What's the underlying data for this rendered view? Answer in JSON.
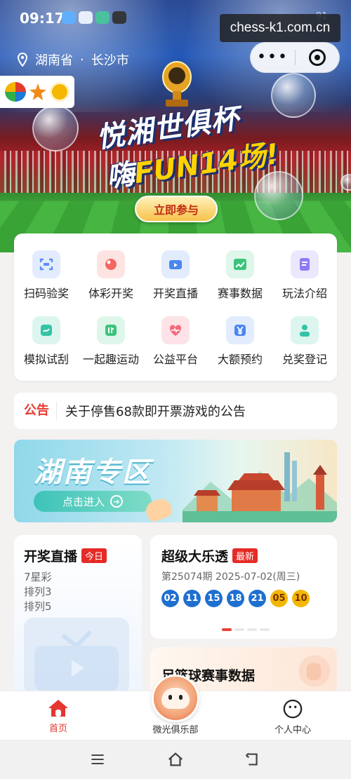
{
  "status_bar": {
    "time": "09:17",
    "battery": "91"
  },
  "watermark": "chess-k1.com.cn",
  "location": {
    "province": "湖南省",
    "separator": "·",
    "city": "长沙市"
  },
  "capsule": {
    "more_glyph": "•••"
  },
  "hero": {
    "headline_line1": "悦湘世俱杯",
    "headline_line2_prefix": "嗨",
    "headline_line2_highlight": "FUN14场!",
    "cta_label": "立即参与"
  },
  "services": [
    {
      "label": "扫码验奖",
      "icon": "scan-icon",
      "color": "#5b8ff5"
    },
    {
      "label": "体彩开奖",
      "icon": "lottery-ball-icon",
      "color": "#f2675f"
    },
    {
      "label": "开奖直播",
      "icon": "live-video-icon",
      "color": "#4a86f0"
    },
    {
      "label": "赛事数据",
      "icon": "chart-icon",
      "color": "#3cc47c"
    },
    {
      "label": "玩法介绍",
      "icon": "doc-icon",
      "color": "#8d7cf3"
    },
    {
      "label": "模拟试刮",
      "icon": "scratch-icon",
      "color": "#34c3a6"
    },
    {
      "label": "一起趣运动",
      "icon": "sport-icon",
      "color": "#3cc47c"
    },
    {
      "label": "公益平台",
      "icon": "heart-icon",
      "color": "#f36a7a"
    },
    {
      "label": "大额预约",
      "icon": "yuan-icon",
      "color": "#4a86f0"
    },
    {
      "label": "兑奖登记",
      "icon": "register-icon",
      "color": "#34c3a6"
    }
  ],
  "notice": {
    "tag": "公告",
    "text": "关于停售68款即开票游戏的公告"
  },
  "zone": {
    "title": "湖南专区",
    "enter_label": "点击进入"
  },
  "live_card": {
    "title": "开奖直播",
    "badge": "今日",
    "games": [
      "7星彩",
      "排列3",
      "排列5"
    ]
  },
  "lotto_card": {
    "title": "超级大乐透",
    "badge": "最新",
    "issue": "第25074期 2025-07-02(周三)",
    "front_numbers": [
      "02",
      "11",
      "15",
      "18",
      "21"
    ],
    "back_numbers": [
      "05",
      "10"
    ]
  },
  "football_card": {
    "title": "足篮球赛事数据"
  },
  "tabbar": {
    "home_label": "首页",
    "club_label": "微光俱乐部",
    "profile_label": "个人中心",
    "active_color": "#e5362f"
  }
}
